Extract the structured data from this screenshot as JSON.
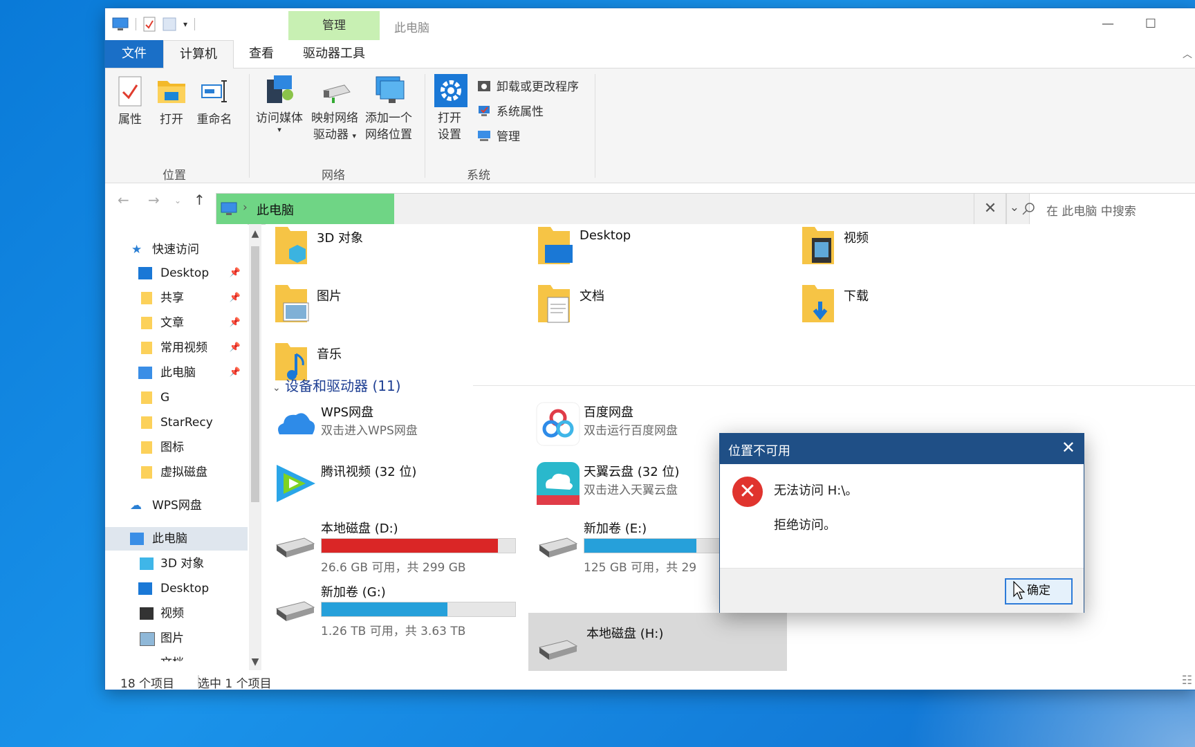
{
  "window": {
    "title": "此电脑",
    "context_tab_header": "管理",
    "controls": {
      "minimize": "—",
      "maximize": "☐"
    }
  },
  "ribbon_tabs": [
    {
      "label": "文件"
    },
    {
      "label": "计算机"
    },
    {
      "label": "查看"
    },
    {
      "label": "驱动器工具"
    }
  ],
  "ribbon": {
    "location_group": {
      "label": "位置",
      "buttons": [
        "属性",
        "打开",
        "重命名"
      ]
    },
    "network_group": {
      "label": "网络",
      "access_media": "访问媒体",
      "map_drive_1": "映射网络",
      "map_drive_2": "驱动器",
      "add_location_1": "添加一个",
      "add_location_2": "网络位置"
    },
    "system_group": {
      "label": "系统",
      "open_settings_1": "打开",
      "open_settings_2": "设置",
      "uninstall": "卸载或更改程序",
      "system_properties": "系统属性",
      "manage": "管理"
    }
  },
  "address": {
    "path": "此电脑",
    "search_placeholder": "在 此电脑 中搜索"
  },
  "nav_pane": {
    "quick_access": "快速访问",
    "items": [
      {
        "label": "Desktop",
        "pinned": true
      },
      {
        "label": "共享",
        "pinned": true
      },
      {
        "label": "文章",
        "pinned": true
      },
      {
        "label": "常用视频",
        "pinned": true
      },
      {
        "label": "此电脑",
        "pinned": true
      },
      {
        "label": "G",
        "pinned": false
      },
      {
        "label": "StarRecy",
        "pinned": false
      },
      {
        "label": "图标",
        "pinned": false
      },
      {
        "label": "虚拟磁盘",
        "pinned": false
      }
    ],
    "wps": "WPS网盘",
    "this_pc": "此电脑",
    "pc_children": [
      "3D 对象",
      "Desktop",
      "视频",
      "图片",
      "文档"
    ]
  },
  "folders": [
    "3D 对象",
    "Desktop",
    "视频",
    "图片",
    "文档",
    "下载",
    "音乐"
  ],
  "devices_section": "设备和驱动器 (11)",
  "drives": [
    {
      "name": "WPS网盘",
      "sub": "双击进入WPS网盘"
    },
    {
      "name": "百度网盘",
      "sub": "双击运行百度网盘"
    },
    {
      "name": "腾讯视频 (32 位)"
    },
    {
      "name": "天翼云盘 (32 位)",
      "sub": "双击进入天翼云盘"
    },
    {
      "name": "本地磁盘 (D:)",
      "cap": "26.6 GB 可用，共 299 GB",
      "used_fraction": 0.91,
      "color": "#da2626"
    },
    {
      "name": "新加卷 (E:)",
      "cap": "125 GB 可用，共 29",
      "used_fraction": 0.58,
      "color": "#26a0da"
    },
    {
      "name": "新加卷 (G:)",
      "cap": "1.26 TB 可用，共 3.63 TB",
      "used_fraction": 0.65,
      "color": "#26a0da"
    },
    {
      "name": "本地磁盘 (H:)"
    }
  ],
  "status": {
    "count": "18 个项目",
    "selected": "选中 1 个项目"
  },
  "dialog": {
    "title": "位置不可用",
    "message": "无法访问 H:\\。",
    "detail": "拒绝访问。",
    "ok": "确定"
  }
}
